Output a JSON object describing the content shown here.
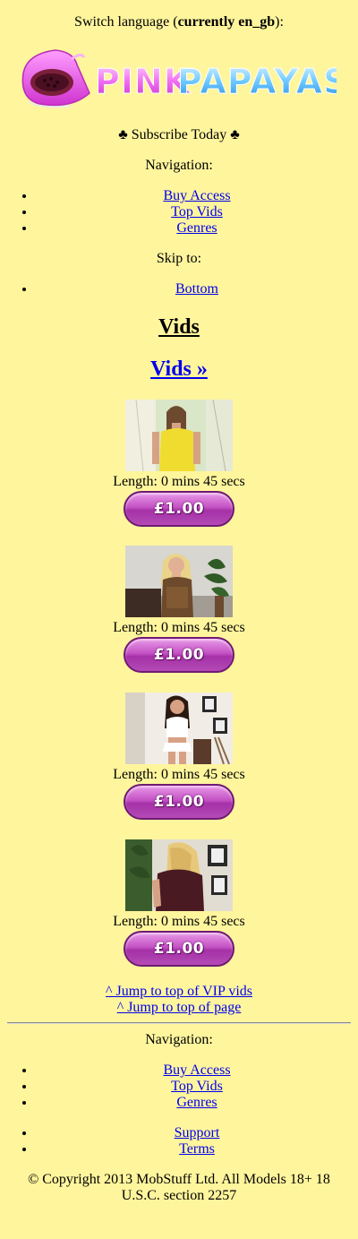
{
  "language": {
    "prefix": "Switch language (",
    "current": "currently en_gb",
    "suffix": "):"
  },
  "logo": {
    "text": "PINKPAPAYAS",
    "part1": "PINK",
    "part2": "PAPAYAS"
  },
  "subscribe": "♣ Subscribe Today ♣",
  "nav_top": {
    "label": "Navigation:",
    "items": [
      "Buy Access",
      "Top Vids",
      "Genres"
    ]
  },
  "skip": {
    "label": "Skip to:",
    "items": [
      "Bottom"
    ]
  },
  "section": {
    "heading": "Vids",
    "link": "Vids »"
  },
  "vids": [
    {
      "length": "Length: 0 mins 45 secs",
      "price": "£1.00"
    },
    {
      "length": "Length: 0 mins 45 secs",
      "price": "£1.00"
    },
    {
      "length": "Length: 0 mins 45 secs",
      "price": "£1.00"
    },
    {
      "length": "Length: 0 mins 45 secs",
      "price": "£1.00"
    }
  ],
  "jump": {
    "vip": "^ Jump to top of VIP vids",
    "page": "^ Jump to top of page"
  },
  "nav_bottom": {
    "label": "Navigation:",
    "items": [
      "Buy Access",
      "Top Vids",
      "Genres"
    ]
  },
  "support_items": [
    "Support",
    "Terms"
  ],
  "copyright": "© Copyright 2013 MobStuff Ltd. All Models 18+ 18 U.S.C. section 2257",
  "colors": {
    "background": "#fff59d",
    "link": "#0000ee",
    "button": "#b44ab6"
  }
}
